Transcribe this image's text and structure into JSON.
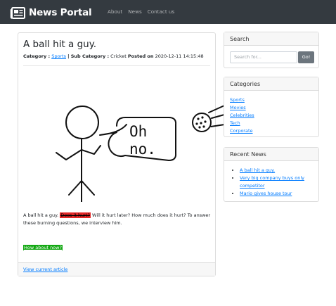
{
  "navbar": {
    "brand": "News Portal",
    "links": [
      "About",
      "News",
      "Contact us"
    ]
  },
  "post": {
    "title": "A ball hit a guy.",
    "category_label": "Category :",
    "category": "Sports",
    "subcategory_label": "| Sub Category :",
    "subcategory": "Cricket",
    "posted_label": "Posted on",
    "posted_on": "2020-12-11 14:15:48",
    "speech": [
      "Oh",
      "no."
    ],
    "body_before": "A ball hit a guy.",
    "body_highlight": "Does it hurt?",
    "body_after": "Will it hurt later? How much does it hurt? To answer these burning questions, we interview him.",
    "green_link": "How about now?",
    "footer_link": "View current article"
  },
  "sidebar": {
    "search": {
      "title": "Search",
      "placeholder": "Search for...",
      "button": "Go!"
    },
    "categories": {
      "title": "Categories",
      "items": [
        "Sports",
        "Movies",
        "Celebrities",
        "Tech",
        "Corporate"
      ]
    },
    "recent": {
      "title": "Recent News",
      "items": [
        "A ball hit a guy.",
        "Very big company buys only competitor",
        "Mario gives house tour"
      ]
    }
  },
  "colors": {
    "navbar": "#343a40",
    "link": "#007bff",
    "highlight_red": "#e52a2a",
    "highlight_green": "#12a812"
  }
}
